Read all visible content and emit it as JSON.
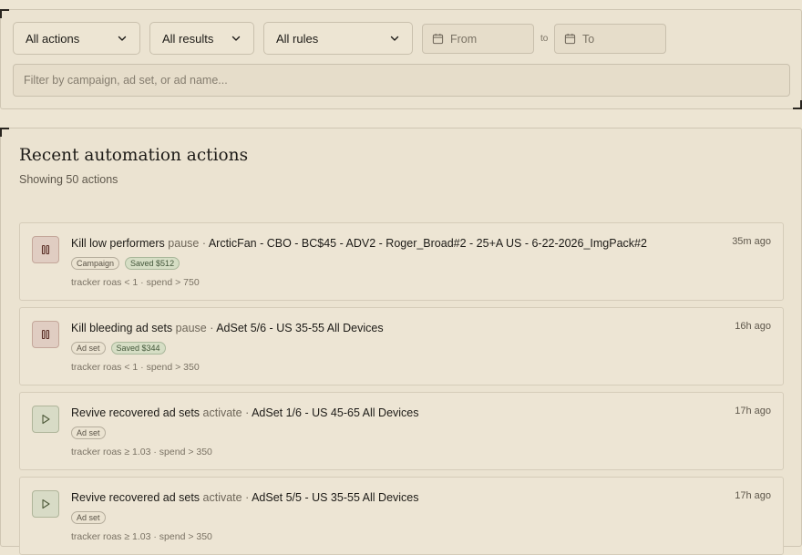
{
  "filters": {
    "action_select": "All actions",
    "result_select": "All results",
    "rule_select": "All rules",
    "from_placeholder": "From",
    "to_label": "to",
    "to_placeholder": "To",
    "search_placeholder": "Filter by campaign, ad set, or ad name..."
  },
  "recent": {
    "title": "Recent automation actions",
    "subtitle": "Showing 50 actions",
    "actions": [
      {
        "icon": "pause-icon",
        "rule": "Kill low performers",
        "verb": "pause",
        "separator": "·",
        "target": "ArcticFan - CBO - BC$45 - ADV2 - Roger_Broad#2 - 25+A US - 6-22-2026_ImgPack#2",
        "time": "35m ago",
        "level": "Campaign",
        "saved": "Saved $512",
        "condition": "tracker roas < 1 · spend > 750"
      },
      {
        "icon": "pause-icon",
        "rule": "Kill bleeding ad sets",
        "verb": "pause",
        "separator": "·",
        "target": "AdSet 5/6 - US 35-55 All Devices",
        "time": "16h ago",
        "level": "Ad set",
        "saved": "Saved $344",
        "condition": "tracker roas < 1 · spend > 350"
      },
      {
        "icon": "play-icon",
        "rule": "Revive recovered ad sets",
        "verb": "activate",
        "separator": "·",
        "target": "AdSet 1/6 - US 45-65 All Devices",
        "time": "17h ago",
        "level": "Ad set",
        "condition": "tracker roas ≥ 1.03 · spend > 350"
      },
      {
        "icon": "play-icon",
        "rule": "Revive recovered ad sets",
        "verb": "activate",
        "separator": "·",
        "target": "AdSet 5/5 - US 35-55 All Devices",
        "time": "17h ago",
        "level": "Ad set",
        "condition": "tracker roas ≥ 1.03 · spend > 350"
      }
    ]
  },
  "colors": {
    "background": "#ede5d3",
    "pause_icon_bg": "#e0cdc2",
    "play_icon_bg": "#d8dbc6",
    "saved_badge_bg": "#d6dec5"
  }
}
